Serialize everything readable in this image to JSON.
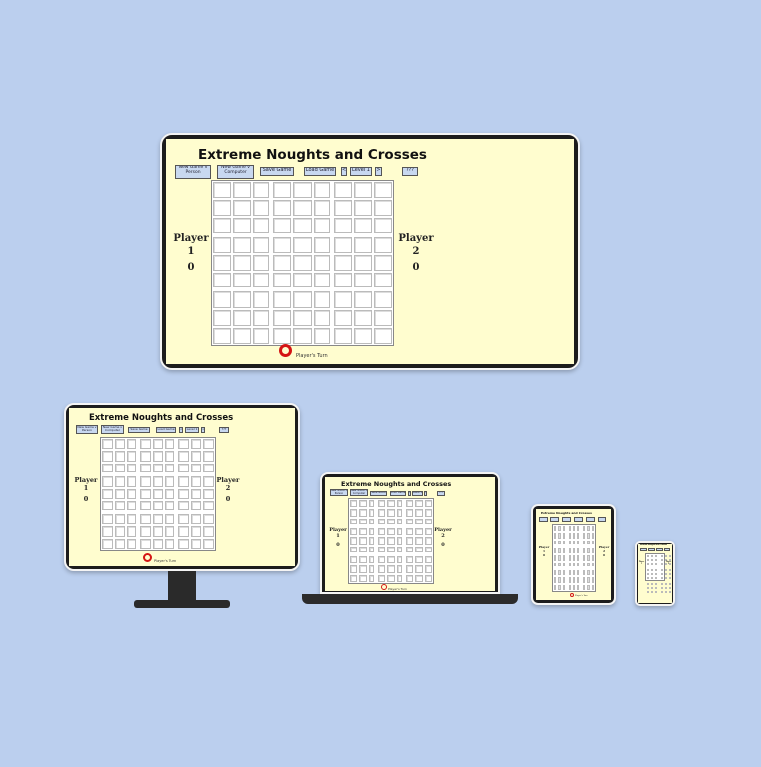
{
  "app": {
    "title": "Extreme Noughts and Crosses",
    "buttons": {
      "new_game_person": "New Game v Person",
      "new_game_computer": "New Game v Computer",
      "save_game": "Save Game",
      "load_game": "Load Game",
      "level_dec": "<",
      "level": "Level 1",
      "level_inc": ">",
      "help": "???"
    },
    "player1": {
      "label": "Player",
      "number": "1",
      "score": "0"
    },
    "player2": {
      "label": "Player",
      "number": "2",
      "score": "0"
    },
    "turn_text": "Player's Turn",
    "turn_symbol": "nought",
    "board_size": 9,
    "colors": {
      "background": "#bbcfee",
      "screen": "#fffdcf",
      "button": "#c8d8f0",
      "nought": "#d41414"
    }
  },
  "devices": [
    "tv",
    "desktop-monitor",
    "laptop",
    "tablet",
    "phone"
  ]
}
